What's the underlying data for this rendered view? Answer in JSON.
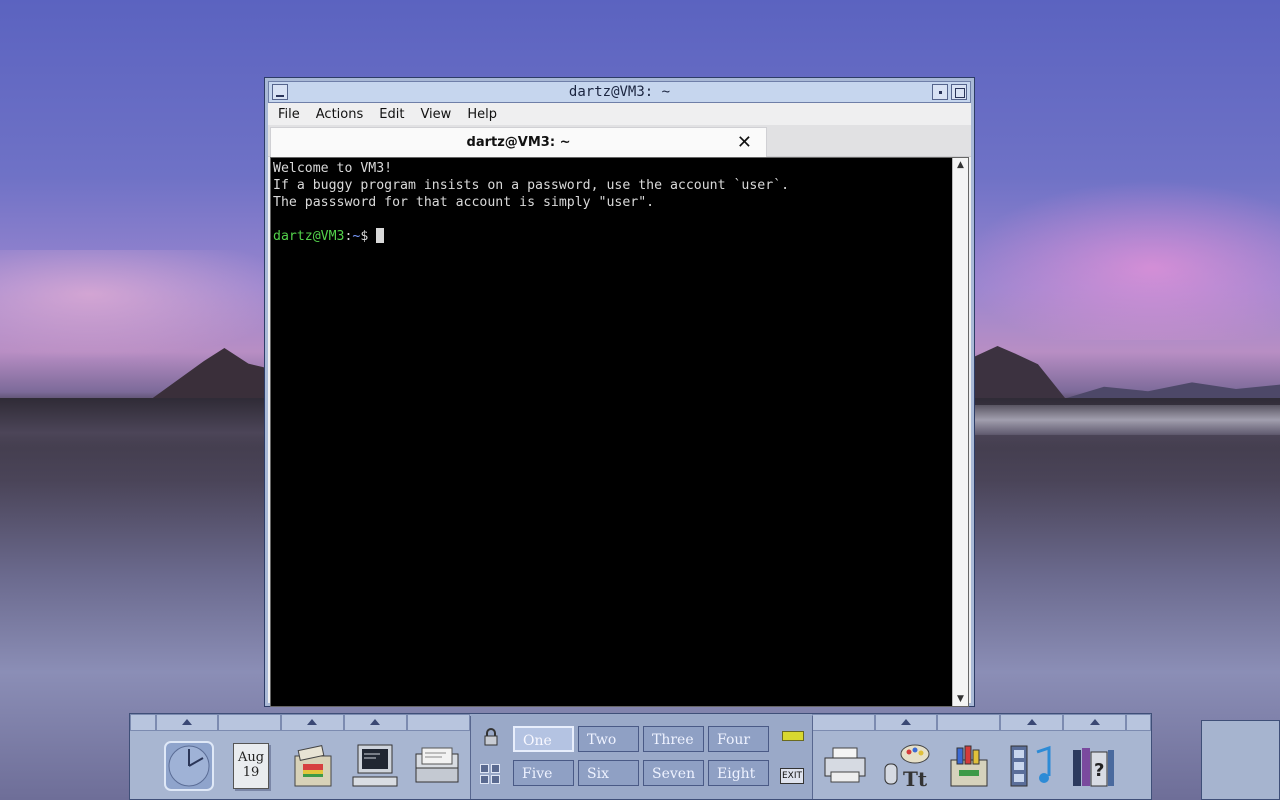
{
  "window": {
    "title": "dartz@VM3: ~",
    "menu": [
      "File",
      "Actions",
      "Edit",
      "View",
      "Help"
    ],
    "tab_title": "dartz@VM3: ~",
    "tab_close": "✕"
  },
  "terminal": {
    "lines": [
      "Welcome to VM3!",
      "If a buggy program insists on a password, use the account `user`.",
      "The passsword for that account is simply \"user\"."
    ],
    "prompt_user": "dartz@VM3",
    "prompt_sep": ":",
    "prompt_path": "~",
    "prompt_symbol": "$ "
  },
  "panel": {
    "calendar_month": "Aug",
    "calendar_day": "19",
    "workspaces": [
      "One",
      "Two",
      "Three",
      "Four",
      "Five",
      "Six",
      "Seven",
      "Eight"
    ],
    "active_workspace": "One",
    "exit_label": "EXIT",
    "icons": [
      "clock-icon",
      "calendar-icon",
      "file-manager-icon",
      "terminal-icon",
      "mailer-icon",
      "printer-icon",
      "style-manager-icon",
      "application-manager-icon",
      "media-player-icon",
      "help-manager-icon"
    ]
  },
  "colors": {
    "prompt_user": "#53d14b",
    "prompt_path": "#7b9cff",
    "panel": "#a8b6d1",
    "titlebar": "#c6d6ee"
  }
}
